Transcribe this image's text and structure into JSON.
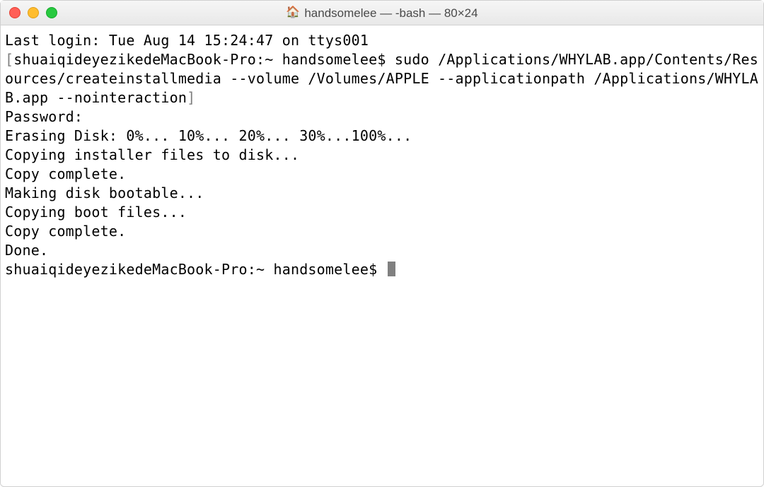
{
  "window": {
    "title": "handsomelee — -bash — 80×24"
  },
  "terminal": {
    "last_login": "Last login: Tue Aug 14 15:24:47 on ttys001",
    "prompt_host": "shuaiqideyezikedeMacBook-Pro:~ handsomelee$",
    "command": "sudo /Applications/WHYLAB.app/Contents/Resources/createinstallmedia --volume /Volumes/APPLE --applicationpath /Applications/WHYLAB.app --nointeraction",
    "password_label": "Password:",
    "lines": {
      "erasing": "Erasing Disk: 0%... 10%... 20%... 30%...100%...",
      "copy1": "Copying installer files to disk...",
      "complete1": "Copy complete.",
      "bootable": "Making disk bootable...",
      "copy2": "Copying boot files...",
      "complete2": "Copy complete.",
      "done": "Done."
    },
    "prompt2_host": "shuaiqideyezikedeMacBook-Pro:~ handsomelee$"
  },
  "icons": {
    "home": "🏠"
  }
}
